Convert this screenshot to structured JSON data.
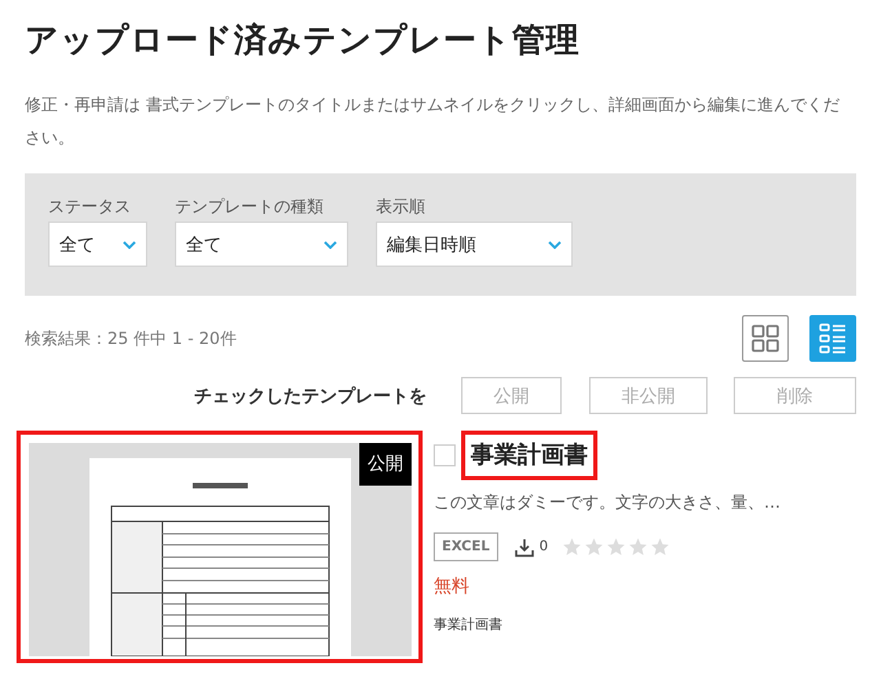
{
  "page_title": "アップロード済みテンプレート管理",
  "intro": "修正・再申請は 書式テンプレートのタイトルまたはサムネイルをクリックし、詳細画面から編集に進んでください。",
  "filters": [
    {
      "label": "ステータス",
      "value": "全て"
    },
    {
      "label": "テンプレートの種類",
      "value": "全て"
    },
    {
      "label": "表示順",
      "value": "編集日時順"
    }
  ],
  "result_count": "検索結果：25 件中 1 - 20件",
  "view_modes": [
    {
      "kind": "grid",
      "selected": false
    },
    {
      "kind": "list",
      "selected": true
    }
  ],
  "bulk_action": {
    "label": "チェックしたテンプレートを",
    "buttons": [
      "公開",
      "非公開",
      "削除"
    ]
  },
  "templates": [
    {
      "status": "公開",
      "checked": false,
      "title": "事業計画書",
      "description": "この文章はダミーです。文字の大きさ、量、…",
      "format": "EXCEL",
      "downloads": "0",
      "stars": 0,
      "price": "無料",
      "category": "事業計画書"
    }
  ]
}
